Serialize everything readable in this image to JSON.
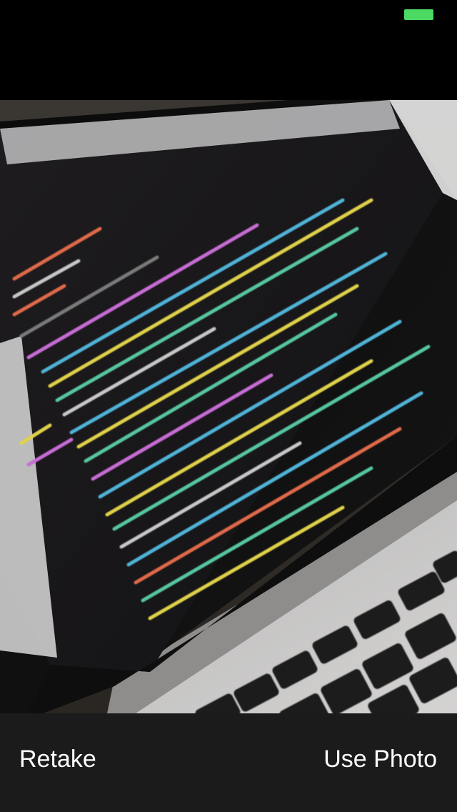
{
  "status_bar": {
    "battery_color": "#4cd964"
  },
  "photo": {
    "subject": "laptop-screen-with-code-editor"
  },
  "toolbar": {
    "retake_label": "Retake",
    "use_photo_label": "Use Photo"
  }
}
